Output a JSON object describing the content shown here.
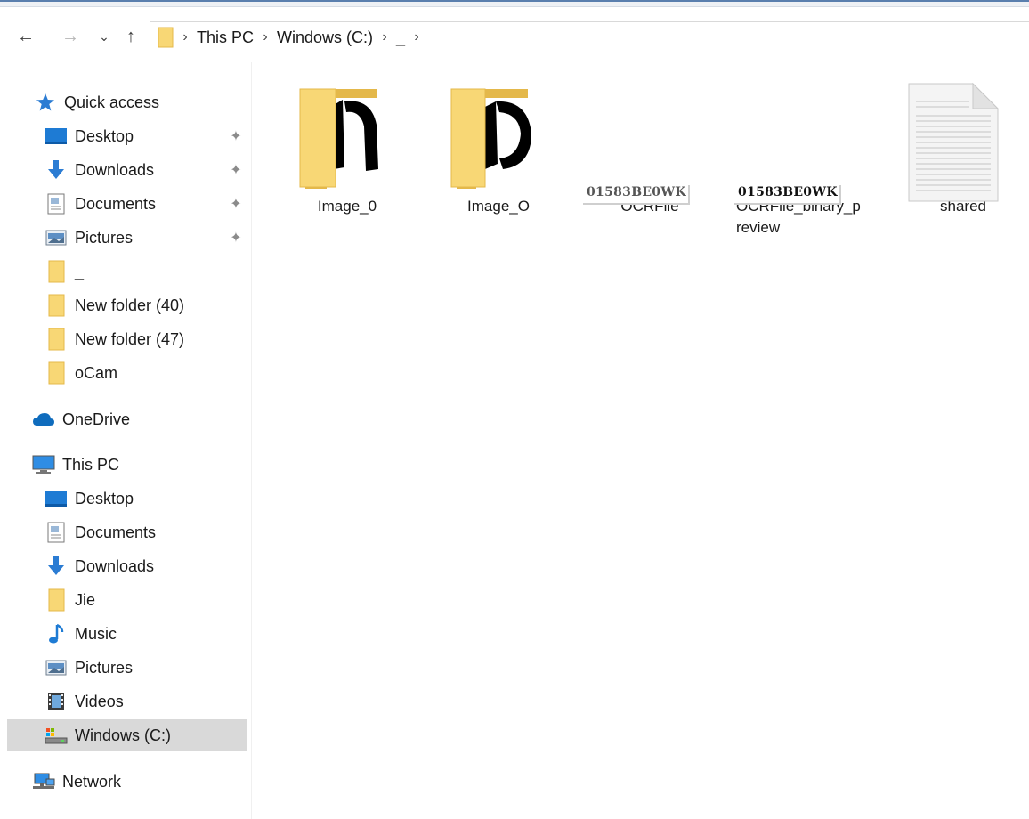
{
  "address_bar": {
    "back_label": "←",
    "forward_label": "→",
    "recent_label": "⌄",
    "up_label": "↑",
    "breadcrumbs": [
      "This PC",
      "Windows (C:)",
      "_"
    ],
    "separator": "›"
  },
  "sidebar": {
    "quick_access": {
      "label": "Quick access",
      "items": [
        {
          "label": "Desktop",
          "icon": "desktop-icon",
          "pinned": true
        },
        {
          "label": "Downloads",
          "icon": "downloads-icon",
          "pinned": true
        },
        {
          "label": "Documents",
          "icon": "documents-icon",
          "pinned": true
        },
        {
          "label": "Pictures",
          "icon": "pictures-icon",
          "pinned": true
        },
        {
          "label": "_",
          "icon": "folder-icon",
          "pinned": false
        },
        {
          "label": "New folder (40)",
          "icon": "folder-icon",
          "pinned": false
        },
        {
          "label": "New folder (47)",
          "icon": "folder-icon",
          "pinned": false
        },
        {
          "label": "oCam",
          "icon": "folder-icon",
          "pinned": false
        }
      ]
    },
    "onedrive": {
      "label": "OneDrive"
    },
    "this_pc": {
      "label": "This PC",
      "items": [
        {
          "label": "Desktop",
          "icon": "desktop-icon"
        },
        {
          "label": "Documents",
          "icon": "documents-icon"
        },
        {
          "label": "Downloads",
          "icon": "downloads-icon"
        },
        {
          "label": "Jie",
          "icon": "folder-icon"
        },
        {
          "label": "Music",
          "icon": "music-icon"
        },
        {
          "label": "Pictures",
          "icon": "pictures-icon"
        },
        {
          "label": "Videos",
          "icon": "videos-icon"
        },
        {
          "label": "Windows (C:)",
          "icon": "drive-icon",
          "selected": true
        }
      ]
    },
    "network": {
      "label": "Network"
    }
  },
  "files": [
    {
      "name": "Image_0",
      "type": "folder"
    },
    {
      "name": "Image_O",
      "type": "folder"
    },
    {
      "name": "OCRFile",
      "type": "image",
      "preview_text": "01583BE0WK"
    },
    {
      "name": "OCRFile_binary_p\nreview",
      "type": "image",
      "preview_text": "01583BE0WK"
    },
    {
      "name": "shared",
      "type": "document"
    }
  ],
  "colors": {
    "folder": "#f8d775",
    "folder_dark": "#e4b84a",
    "accent_blue": "#2b7cd3",
    "selection": "#d9d9d9"
  }
}
